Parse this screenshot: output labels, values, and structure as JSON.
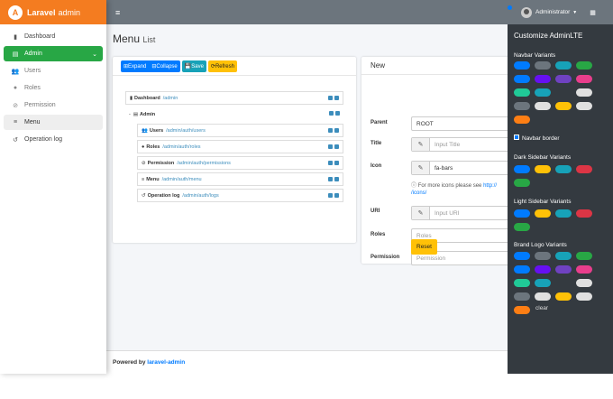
{
  "brand": {
    "name": "Laravel",
    "suffix": "admin",
    "logo_letter": "A"
  },
  "sidebar": {
    "items": [
      {
        "label": "Dashboard",
        "icon": "bar-chart-icon",
        "glyph": "▮"
      },
      {
        "label": "Admin",
        "icon": "tasks-icon",
        "glyph": "▤",
        "active": true
      },
      {
        "label": "Users",
        "icon": "users-icon",
        "glyph": "👥"
      },
      {
        "label": "Roles",
        "icon": "user-icon",
        "glyph": "●"
      },
      {
        "label": "Permission",
        "icon": "ban-icon",
        "glyph": "⊘"
      },
      {
        "label": "Menu",
        "icon": "bars-icon",
        "glyph": "≡"
      },
      {
        "label": "Operation log",
        "icon": "history-icon",
        "glyph": "↺"
      }
    ]
  },
  "topbar": {
    "menu_glyph": "≡"
  },
  "user": {
    "name": "Administrator"
  },
  "page": {
    "title": "Menu",
    "subtitle": "List"
  },
  "toolbar": {
    "expand": "⊞Expand",
    "collapse": "⊟Collapse",
    "save": "💾Save",
    "refresh": "⟳Refresh"
  },
  "tree": [
    {
      "glyph": "▮",
      "name": "Dashboard",
      "path": "/admin"
    },
    {
      "glyph": "▤",
      "name": "Admin",
      "path": "",
      "toggle": "-"
    },
    {
      "glyph": "👥",
      "name": "Users",
      "path": "/admin/auth/users"
    },
    {
      "glyph": "●",
      "name": "Roles",
      "path": "/admin/auth/roles"
    },
    {
      "glyph": "⊘",
      "name": "Permission",
      "path": "/admin/auth/permissions"
    },
    {
      "glyph": "≡",
      "name": "Menu",
      "path": "/admin/auth/menu"
    },
    {
      "glyph": "↺",
      "name": "Operation log",
      "path": "/admin/auth/logs"
    }
  ],
  "form": {
    "heading": "New",
    "parent_label": "Parent",
    "parent_value": "ROOT",
    "title_label": "Title",
    "title_placeholder": "Input Title",
    "icon_label": "Icon",
    "icon_value": "fa-bars",
    "icon_help": "For more icons please see",
    "icon_link": "http://",
    "icon_link2": "/icons/",
    "uri_label": "URI",
    "uri_placeholder": "Input URI",
    "roles_label": "Roles",
    "roles_placeholder": "Roles",
    "permission_label": "Permission",
    "permission_placeholder": "Permission",
    "reset": "Reset"
  },
  "footer": {
    "prefix": "Powered by",
    "link": "laravel-admin"
  },
  "customize": {
    "title": "Customize AdminLTE",
    "navbar_variants": "Navbar Variants",
    "navbar_border": "Navbar border",
    "dark_sidebar": "Dark Sidebar Variants",
    "light_sidebar": "Light Sidebar Variants",
    "brand_logo": "Brand Logo Variants",
    "clear": "clear",
    "navbar_colors": [
      "#007bff",
      "#6c757d",
      "#17a2b8",
      "#28a745",
      "#007bff",
      "#6610f2",
      "#6f42c1",
      "#e83e8c",
      "#20c997",
      "#17a2b8",
      "#343a40",
      "#e0e0e0",
      "#6c757d",
      "#e0e0e0",
      "#ffc107",
      "#e0e0e0",
      "#fd7e14"
    ],
    "dark_colors": [
      "#007bff",
      "#ffc107",
      "#17a2b8",
      "#dc3545",
      "#28a745"
    ],
    "light_colors": [
      "#007bff",
      "#ffc107",
      "#17a2b8",
      "#dc3545",
      "#28a745"
    ],
    "brand_colors": [
      "#007bff",
      "#6c757d",
      "#17a2b8",
      "#28a745",
      "#007bff",
      "#6610f2",
      "#6f42c1",
      "#e83e8c",
      "#20c997",
      "#17a2b8",
      "#343a40",
      "#e0e0e0",
      "#6c757d",
      "#e0e0e0",
      "#ffc107",
      "#e0e0e0",
      "#fd7e14"
    ]
  }
}
